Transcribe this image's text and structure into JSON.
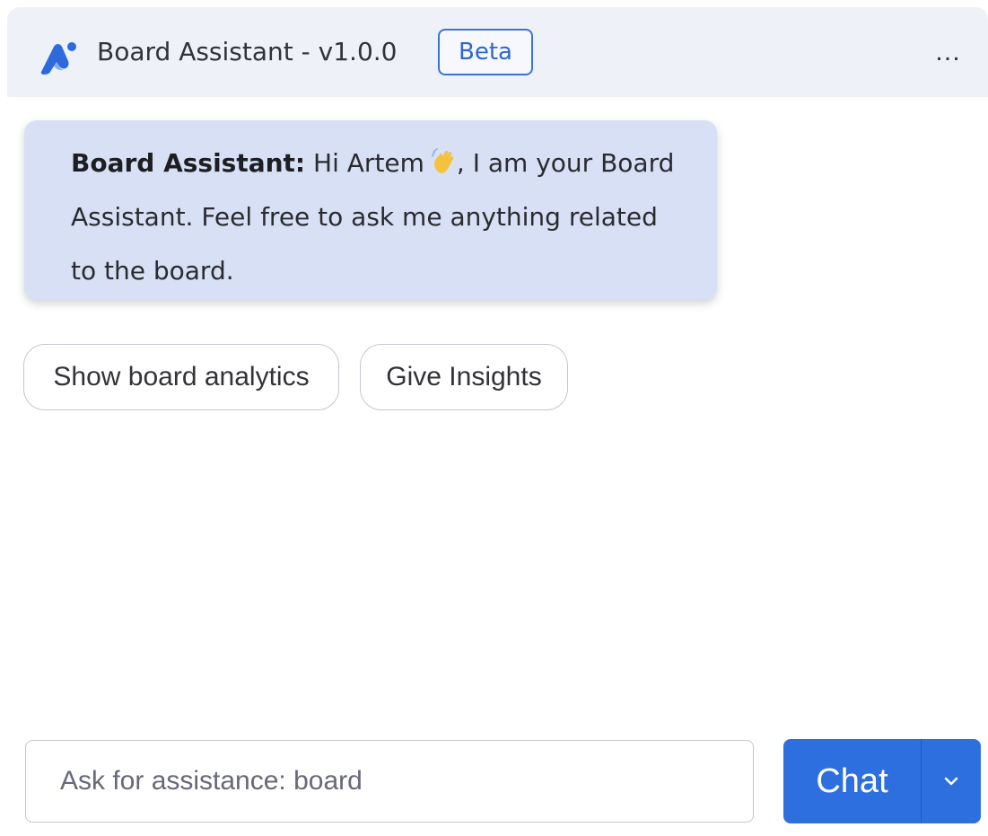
{
  "header": {
    "title": "Board Assistant - v1.0.0",
    "badge": "Beta",
    "logo_icon": "board-assistant-logo-icon",
    "menu_icon": "more-horizontal-icon",
    "menu_glyph": "…"
  },
  "message": {
    "sender": "Board Assistant:",
    "text_before_emoji": " Hi Artem",
    "emoji_icon": "waving-hand-icon",
    "text_after_emoji": ", I am your Board Assistant. Feel free to ask me anything related to the board."
  },
  "suggestions": [
    {
      "label": "Show board analytics"
    },
    {
      "label": "Give Insights"
    }
  ],
  "composer": {
    "placeholder": "Ask for assistance: board",
    "value": "",
    "submit_label": "Chat",
    "dropdown_icon": "chevron-down-icon"
  },
  "colors": {
    "header_bg": "#eef1f8",
    "accent": "#2e6fe0",
    "message_bg": "#d7e0f4",
    "badge_border": "#3b72d9"
  }
}
